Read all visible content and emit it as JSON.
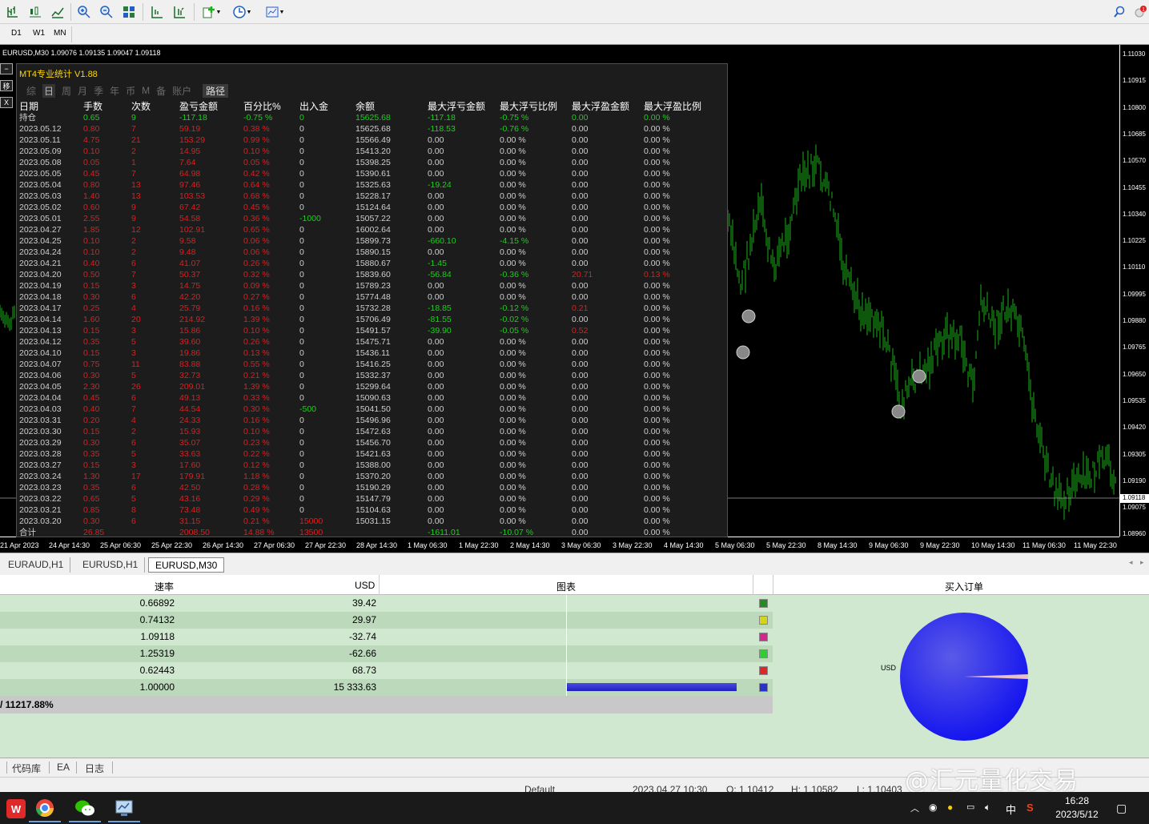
{
  "toolbar": {
    "icons": [
      "bar-chart-icon",
      "candle-chart-icon",
      "line-chart-icon",
      "zoom-in-icon",
      "zoom-out-icon",
      "tile-windows-icon",
      "chart-shift-icon",
      "autoscroll-icon",
      "add-indicator-icon",
      "periodicity-icon",
      "templates-icon",
      "search-icon",
      "notification-icon"
    ]
  },
  "periods": [
    "D1",
    "W1",
    "MN"
  ],
  "chart": {
    "title": "EURUSD,M30  1.09076 1.09135 1.09047 1.09118",
    "current_price": "1.09118",
    "y_ticks": [
      "1.11030",
      "1.10915",
      "1.10800",
      "1.10685",
      "1.10570",
      "1.10455",
      "1.10340",
      "1.10225",
      "1.10110",
      "1.09995",
      "1.09880",
      "1.09765",
      "1.09650",
      "1.09535",
      "1.09420",
      "1.09305",
      "1.09190",
      "1.09075",
      "1.08960"
    ],
    "x_ticks": [
      "21 Apr 2023",
      "24 Apr 14:30",
      "25 Apr 06:30",
      "25 Apr 22:30",
      "26 Apr 14:30",
      "27 Apr 06:30",
      "27 Apr 22:30",
      "28 Apr 14:30",
      "1 May 06:30",
      "1 May 22:30",
      "2 May 14:30",
      "3 May 06:30",
      "3 May 22:30",
      "4 May 14:30",
      "5 May 06:30",
      "5 May 22:30",
      "8 May 14:30",
      "9 May 06:30",
      "9 May 22:30",
      "10 May 14:30",
      "11 May 06:30",
      "11 May 22:30"
    ]
  },
  "stats": {
    "title": "MT4专业统计 V1.88",
    "tabs": [
      "综",
      "日",
      "周",
      "月",
      "季",
      "年",
      "币",
      "M",
      "备",
      "账户"
    ],
    "path_tab": "路径",
    "side_buttons": [
      "移",
      "X"
    ],
    "headers": [
      "日期",
      "手数",
      "次数",
      "盈亏金额",
      "百分比%",
      "出入金",
      "余额",
      "最大浮亏金额",
      "最大浮亏比例",
      "最大浮盈金额",
      "最大浮盈比例"
    ],
    "rows": [
      [
        "持仓",
        "0.65",
        "9",
        "-117.18",
        "-0.75 %",
        "0",
        "15625.68",
        "-117.18",
        "-0.75 %",
        "0.00",
        "0.00 %"
      ],
      [
        "2023.05.12",
        "0.80",
        "7",
        "59.19",
        "0.38 %",
        "0",
        "15625.68",
        "-118.53",
        "-0.76 %",
        "0.00",
        "0.00 %"
      ],
      [
        "2023.05.11",
        "4.75",
        "21",
        "153.29",
        "0.99 %",
        "0",
        "15566.49",
        "0.00",
        "0.00 %",
        "0.00",
        "0.00 %"
      ],
      [
        "2023.05.09",
        "0.10",
        "2",
        "14.95",
        "0.10 %",
        "0",
        "15413.20",
        "0.00",
        "0.00 %",
        "0.00",
        "0.00 %"
      ],
      [
        "2023.05.08",
        "0.05",
        "1",
        "7.64",
        "0.05 %",
        "0",
        "15398.25",
        "0.00",
        "0.00 %",
        "0.00",
        "0.00 %"
      ],
      [
        "2023.05.05",
        "0.45",
        "7",
        "64.98",
        "0.42 %",
        "0",
        "15390.61",
        "0.00",
        "0.00 %",
        "0.00",
        "0.00 %"
      ],
      [
        "2023.05.04",
        "0.80",
        "13",
        "97.46",
        "0.64 %",
        "0",
        "15325.63",
        "-19.24",
        "0.00 %",
        "0.00",
        "0.00 %"
      ],
      [
        "2023.05.03",
        "1.40",
        "13",
        "103.53",
        "0.68 %",
        "0",
        "15228.17",
        "0.00",
        "0.00 %",
        "0.00",
        "0.00 %"
      ],
      [
        "2023.05.02",
        "0.60",
        "9",
        "67.42",
        "0.45 %",
        "0",
        "15124.64",
        "0.00",
        "0.00 %",
        "0.00",
        "0.00 %"
      ],
      [
        "2023.05.01",
        "2.55",
        "9",
        "54.58",
        "0.36 %",
        "-1000",
        "15057.22",
        "0.00",
        "0.00 %",
        "0.00",
        "0.00 %"
      ],
      [
        "2023.04.27",
        "1.85",
        "12",
        "102.91",
        "0.65 %",
        "0",
        "16002.64",
        "0.00",
        "0.00 %",
        "0.00",
        "0.00 %"
      ],
      [
        "2023.04.25",
        "0.10",
        "2",
        "9.58",
        "0.06 %",
        "0",
        "15899.73",
        "-660.10",
        "-4.15 %",
        "0.00",
        "0.00 %"
      ],
      [
        "2023.04.24",
        "0.10",
        "2",
        "9.48",
        "0.06 %",
        "0",
        "15890.15",
        "0.00",
        "0.00 %",
        "0.00",
        "0.00 %"
      ],
      [
        "2023.04.21",
        "0.40",
        "6",
        "41.07",
        "0.26 %",
        "0",
        "15880.67",
        "-1.45",
        "0.00 %",
        "0.00",
        "0.00 %"
      ],
      [
        "2023.04.20",
        "0.50",
        "7",
        "50.37",
        "0.32 %",
        "0",
        "15839.60",
        "-56.84",
        "-0.36 %",
        "20.71",
        "0.13 %"
      ],
      [
        "2023.04.19",
        "0.15",
        "3",
        "14.75",
        "0.09 %",
        "0",
        "15789.23",
        "0.00",
        "0.00 %",
        "0.00",
        "0.00 %"
      ],
      [
        "2023.04.18",
        "0.30",
        "6",
        "42.20",
        "0.27 %",
        "0",
        "15774.48",
        "0.00",
        "0.00 %",
        "0.00",
        "0.00 %"
      ],
      [
        "2023.04.17",
        "0.25",
        "4",
        "25.79",
        "0.16 %",
        "0",
        "15732.28",
        "-18.85",
        "-0.12 %",
        "0.21",
        "0.00 %"
      ],
      [
        "2023.04.14",
        "1.60",
        "20",
        "214.92",
        "1.39 %",
        "0",
        "15706.49",
        "-81.55",
        "-0.02 %",
        "0.00",
        "0.00 %"
      ],
      [
        "2023.04.13",
        "0.15",
        "3",
        "15.86",
        "0.10 %",
        "0",
        "15491.57",
        "-39.90",
        "-0.05 %",
        "0.52",
        "0.00 %"
      ],
      [
        "2023.04.12",
        "0.35",
        "5",
        "39.60",
        "0.26 %",
        "0",
        "15475.71",
        "0.00",
        "0.00 %",
        "0.00",
        "0.00 %"
      ],
      [
        "2023.04.10",
        "0.15",
        "3",
        "19.86",
        "0.13 %",
        "0",
        "15436.11",
        "0.00",
        "0.00 %",
        "0.00",
        "0.00 %"
      ],
      [
        "2023.04.07",
        "0.75",
        "11",
        "83.88",
        "0.55 %",
        "0",
        "15416.25",
        "0.00",
        "0.00 %",
        "0.00",
        "0.00 %"
      ],
      [
        "2023.04.06",
        "0.30",
        "5",
        "32.73",
        "0.21 %",
        "0",
        "15332.37",
        "0.00",
        "0.00 %",
        "0.00",
        "0.00 %"
      ],
      [
        "2023.04.05",
        "2.30",
        "26",
        "209.01",
        "1.39 %",
        "0",
        "15299.64",
        "0.00",
        "0.00 %",
        "0.00",
        "0.00 %"
      ],
      [
        "2023.04.04",
        "0.45",
        "6",
        "49.13",
        "0.33 %",
        "0",
        "15090.63",
        "0.00",
        "0.00 %",
        "0.00",
        "0.00 %"
      ],
      [
        "2023.04.03",
        "0.40",
        "7",
        "44.54",
        "0.30 %",
        "-500",
        "15041.50",
        "0.00",
        "0.00 %",
        "0.00",
        "0.00 %"
      ],
      [
        "2023.03.31",
        "0.20",
        "4",
        "24.33",
        "0.16 %",
        "0",
        "15496.96",
        "0.00",
        "0.00 %",
        "0.00",
        "0.00 %"
      ],
      [
        "2023.03.30",
        "0.15",
        "2",
        "15.93",
        "0.10 %",
        "0",
        "15472.63",
        "0.00",
        "0.00 %",
        "0.00",
        "0.00 %"
      ],
      [
        "2023.03.29",
        "0.30",
        "6",
        "35.07",
        "0.23 %",
        "0",
        "15456.70",
        "0.00",
        "0.00 %",
        "0.00",
        "0.00 %"
      ],
      [
        "2023.03.28",
        "0.35",
        "5",
        "33.63",
        "0.22 %",
        "0",
        "15421.63",
        "0.00",
        "0.00 %",
        "0.00",
        "0.00 %"
      ],
      [
        "2023.03.27",
        "0.15",
        "3",
        "17.60",
        "0.12 %",
        "0",
        "15388.00",
        "0.00",
        "0.00 %",
        "0.00",
        "0.00 %"
      ],
      [
        "2023.03.24",
        "1.30",
        "17",
        "179.91",
        "1.18 %",
        "0",
        "15370.20",
        "0.00",
        "0.00 %",
        "0.00",
        "0.00 %"
      ],
      [
        "2023.03.23",
        "0.35",
        "6",
        "42.50",
        "0.28 %",
        "0",
        "15190.29",
        "0.00",
        "0.00 %",
        "0.00",
        "0.00 %"
      ],
      [
        "2023.03.22",
        "0.65",
        "5",
        "43.16",
        "0.29 %",
        "0",
        "15147.79",
        "0.00",
        "0.00 %",
        "0.00",
        "0.00 %"
      ],
      [
        "2023.03.21",
        "0.85",
        "8",
        "73.48",
        "0.49 %",
        "0",
        "15104.63",
        "0.00",
        "0.00 %",
        "0.00",
        "0.00 %"
      ],
      [
        "2023.03.20",
        "0.30",
        "6",
        "31.15",
        "0.21 %",
        "15000",
        "15031.15",
        "0.00",
        "0.00 %",
        "0.00",
        "0.00 %"
      ],
      [
        "合计",
        "26.85",
        "",
        "2008.50",
        "14.88 %",
        "13500",
        "",
        "-1611.01",
        "-10.07 %",
        "0.00",
        "0.00 %"
      ]
    ]
  },
  "bottom_tabs": [
    "EURAUD,H1",
    "EURUSD,H1",
    "EURUSD,M30"
  ],
  "panel": {
    "headers": {
      "rate": "速率",
      "usd": "USD",
      "chart": "图表",
      "buy": "买入订单"
    },
    "rows": [
      {
        "rate": "0.66892",
        "usd": "39.42",
        "color": "#228b22"
      },
      {
        "rate": "0.74132",
        "usd": "29.97",
        "color": "#d4d41e"
      },
      {
        "rate": "1.09118",
        "usd": "-32.74",
        "color": "#d2288c"
      },
      {
        "rate": "1.25319",
        "usd": "-62.66",
        "color": "#32cd32"
      },
      {
        "rate": "0.62443",
        "usd": "68.73",
        "color": "#dc2828"
      },
      {
        "rate": "1.00000",
        "usd": "15 333.63",
        "color": "#2832c8",
        "bar": 0.9
      }
    ],
    "total": "/ 11217.88%",
    "pie_label": "USD"
  },
  "bottom2_tabs": [
    "代码库",
    "EA",
    "日志"
  ],
  "status": {
    "profile": "Default",
    "datetime": "2023.04.27 10:30",
    "open": "O: 1.10412",
    "high": "H: 1.10582",
    "low": "L: 1.10403"
  },
  "watermark": "@汇元量化交易",
  "taskbar": {
    "time": "16:28",
    "date": "2023/5/12",
    "ime": "中",
    "apps": [
      "wps-icon",
      "chrome-icon",
      "wechat-icon",
      "mt4-icon"
    ]
  }
}
